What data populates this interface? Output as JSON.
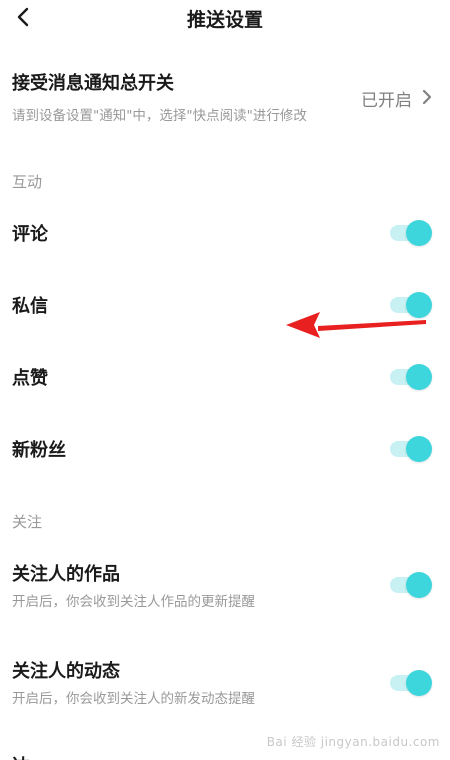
{
  "header": {
    "title": "推送设置",
    "back_icon": "chevron-left-icon"
  },
  "master": {
    "title": "接受消息通知总开关",
    "desc": "请到设备设置\"通知\"中，选择\"快点阅读\"进行修改",
    "status": "已开启"
  },
  "sections": {
    "interaction": {
      "label": "互动",
      "items": [
        {
          "label": "评论",
          "enabled": true
        },
        {
          "label": "私信",
          "enabled": true
        },
        {
          "label": "点赞",
          "enabled": true
        },
        {
          "label": "新粉丝",
          "enabled": true
        }
      ]
    },
    "follow": {
      "label": "关注",
      "items": [
        {
          "title": "关注人的作品",
          "sub": "开启后，你会收到关注人作品的更新提醒",
          "enabled": true
        },
        {
          "title": "关注人的动态",
          "sub": "开启后，你会收到关注人的新发动态提醒",
          "enabled": true
        }
      ]
    },
    "next_partial": {
      "label": "达  "
    }
  },
  "colors": {
    "toggle_on": "#3dd6dd",
    "toggle_track": "#c7f1f3",
    "arrow": "#e8201f"
  },
  "watermark": "Bai 经验 jingyan.baidu.com"
}
